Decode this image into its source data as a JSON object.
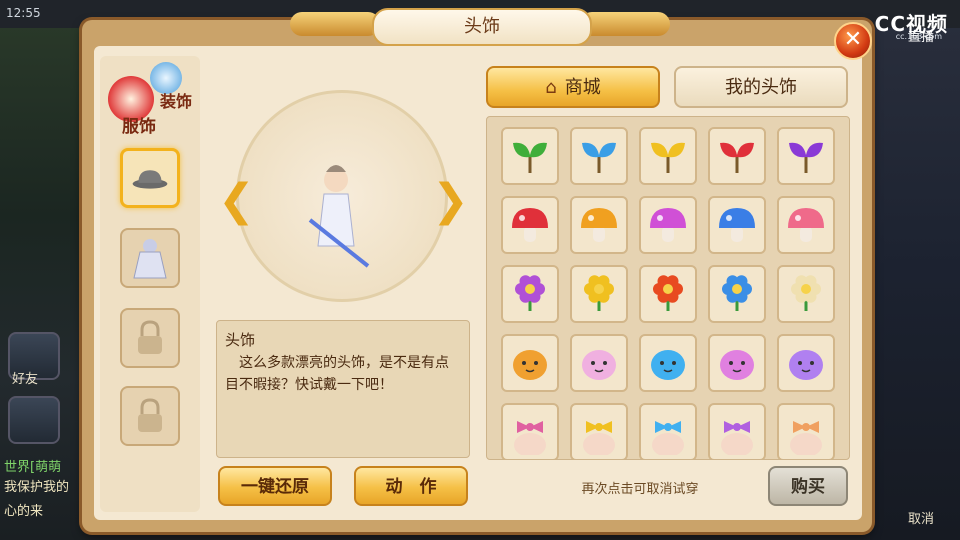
{
  "status": {
    "time": "12:55"
  },
  "overlay": {
    "logo": "CC视频",
    "logo_sub": "cc.163.com",
    "logo_tag": "直播"
  },
  "background": {
    "left_labels": [
      "好友"
    ],
    "chat_lines": [
      "世界[萌萌",
      "我保护我的",
      "心的来"
    ],
    "right_label": "取消"
  },
  "window": {
    "title": "头饰"
  },
  "category": {
    "main_label": "服饰",
    "sub_label": "装饰"
  },
  "slots": [
    {
      "name": "hat",
      "icon": "hat-icon",
      "active": true
    },
    {
      "name": "outfit",
      "icon": "robe-icon",
      "active": false
    },
    {
      "name": "locked-1",
      "icon": "lock-icon",
      "active": false
    },
    {
      "name": "locked-2",
      "icon": "lock-icon",
      "active": false
    }
  ],
  "tabs": {
    "shop": "商城",
    "mine": "我的头饰"
  },
  "description": {
    "title": "头饰",
    "text": "这么多款漂亮的头饰，是不是有点目不暇接？快试戴一下吧！"
  },
  "buttons": {
    "reset": "一键还原",
    "action": "动　作",
    "buy": "购买"
  },
  "hint": "再次点击可取消试穿",
  "colors": {
    "sprout": [
      "#3fae3a",
      "#3a9ee6",
      "#f0c020",
      "#e0303a",
      "#8a3ad6"
    ],
    "mushroom": [
      "#e0303a",
      "#f0a020",
      "#d050d6",
      "#3a7ee6",
      "#ef6a8a"
    ],
    "flower": [
      "#b050d6",
      "#f0c020",
      "#e84a20",
      "#3a8ee6",
      "#f0e0b0"
    ],
    "blob": [
      "#f0a030",
      "#f0b0e0",
      "#40b0f0",
      "#e080e0",
      "#b080f0"
    ],
    "bow": [
      "#e060a0",
      "#f0c020",
      "#40b0f0",
      "#b060e0",
      "#f0a060"
    ]
  }
}
